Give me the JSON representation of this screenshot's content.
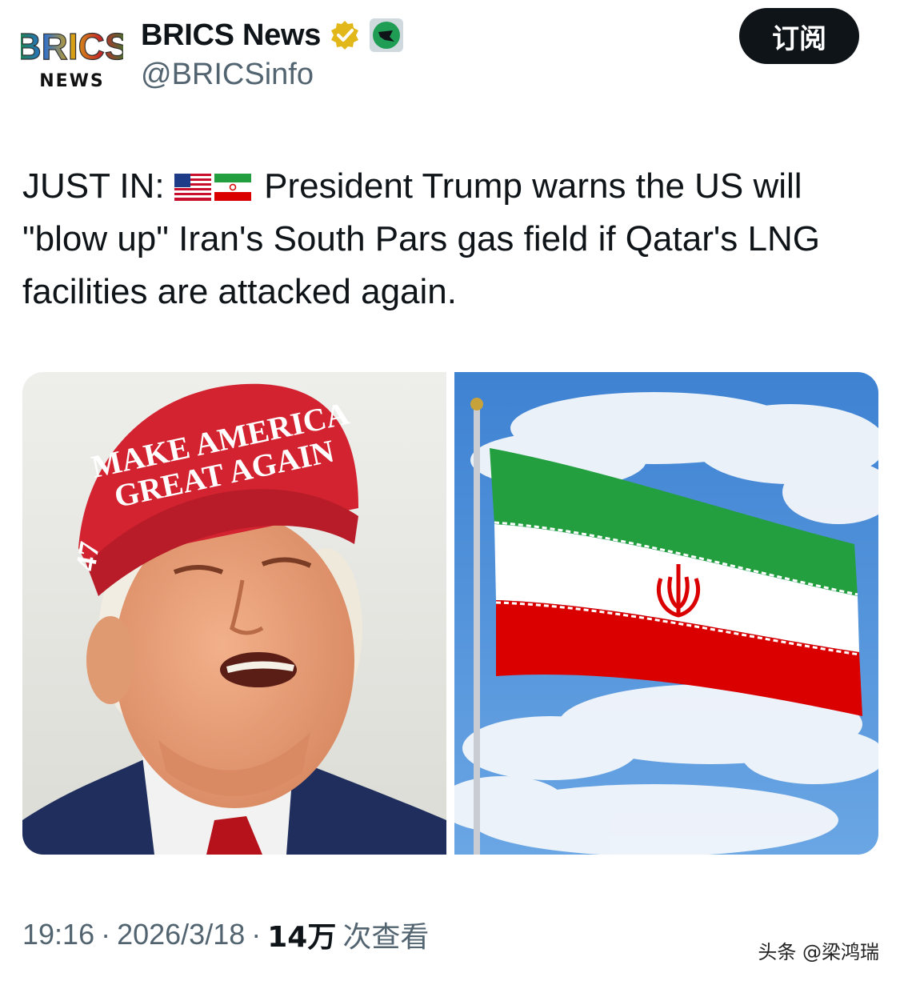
{
  "account": {
    "logo_text_top": "BRICS",
    "logo_text_bottom": "NEWS",
    "display_name": "BRICS News",
    "handle": "@BRICSinfo",
    "subscribe_label": "订阅"
  },
  "tweet": {
    "prefix": "JUST IN:",
    "body": "President Trump warns the US will \"blow up\" Iran's South Pars gas field if Qatar's LNG facilities are attacked again.",
    "flags": [
      "us-flag-icon",
      "iran-flag-icon"
    ]
  },
  "media": {
    "left_image": {
      "cap_line1": "MAKE AMERICA",
      "cap_line2": "GREAT AGAIN",
      "cap_side": "47"
    },
    "right_image": {}
  },
  "meta": {
    "time": "19:16",
    "date": "2026/3/18",
    "separator": "·",
    "views_count": "14万",
    "views_label": "次查看"
  },
  "watermark": "头条 @梁鸿瑞",
  "colors": {
    "cap_red": "#d32330",
    "verified_gold": "#e2b719",
    "iran_green": "#239f40",
    "iran_red": "#da0000",
    "sky_blue": "#4f8fd6",
    "button_dark": "#0f1419",
    "secondary_text": "#536471"
  }
}
